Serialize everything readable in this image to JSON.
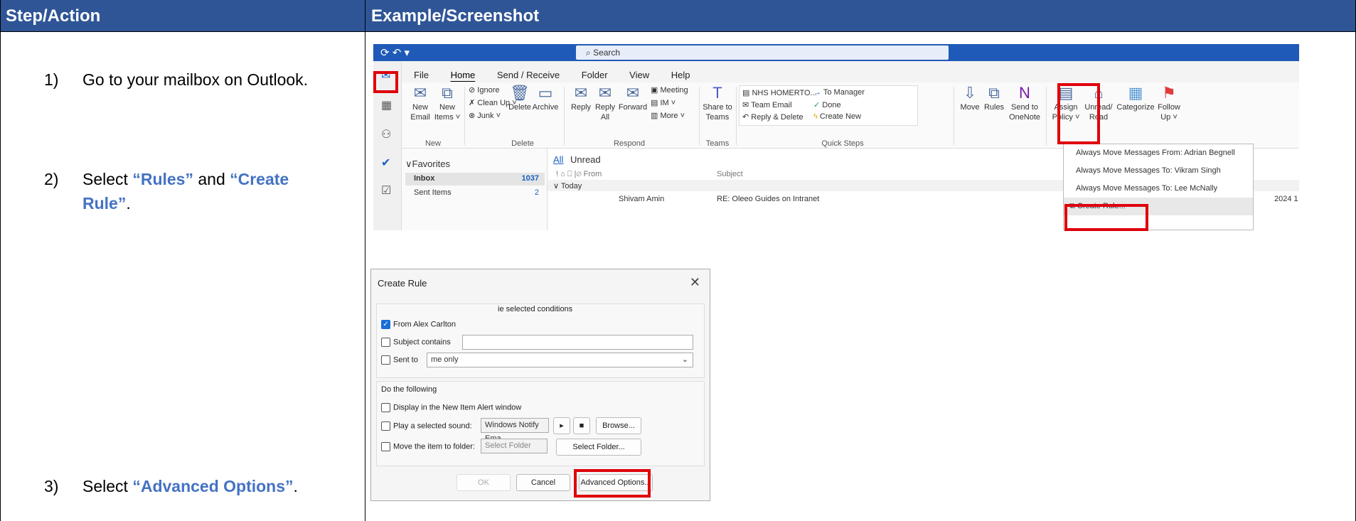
{
  "header": {
    "left": "Step/Action",
    "right": "Example/Screenshot"
  },
  "steps": [
    {
      "num": "1)",
      "text": "Go to your mailbox on Outlook."
    },
    {
      "num": "2)",
      "pre": "Select ",
      "hl1": "“Rules”",
      "mid": " and ",
      "hl2a": "“Create",
      "hl2b": "Rule”",
      "post": "."
    },
    {
      "num": "3)",
      "pre": "Select ",
      "hl": "“Advanced Options”",
      "post": "."
    }
  ],
  "outlook": {
    "search": "Search",
    "menu": [
      "File",
      "Home",
      "Send / Receive",
      "Folder",
      "View",
      "Help"
    ],
    "ribbon": {
      "new_email": "New\nEmail",
      "new_items": "New\nItems ˅",
      "ignore": "Ignore",
      "clean_up": "Clean Up ˅",
      "junk": "Junk ˅",
      "delete": "Delete",
      "archive": "Archive",
      "reply": "Reply",
      "reply_all": "Reply\nAll",
      "forward": "Forward",
      "meeting": "Meeting",
      "im": "IM ˅",
      "more": "More ˅",
      "share_teams": "Share to\nTeams",
      "qs1": "NHS HOMERTO...",
      "qs2": "Team Email",
      "qs3": "Reply & Delete",
      "qs4": "To Manager",
      "qs5": "Done",
      "qs6": "Create New",
      "move": "Move",
      "rules": "Rules",
      "send_onenote": "Send to\nOneNote",
      "assign_policy": "Assign\nPolicy ˅",
      "unread_read": "Unread/\nRead",
      "categorize": "Categorize",
      "follow_up": "Follow\nUp ˅",
      "groups": [
        "New",
        "Delete",
        "Respond",
        "Teams",
        "Quick Steps"
      ]
    },
    "folders": {
      "favorites": "Favorites",
      "inbox": "Inbox",
      "inbox_count": "1037",
      "sent": "Sent Items",
      "sent_count": "2"
    },
    "mail": {
      "tab_all": "All",
      "tab_unread": "Unread",
      "col_from": "From",
      "col_subject": "Subject",
      "group_today": "Today",
      "row_from": "Shivam Amin",
      "row_subject": "RE: Oleeo Guides on Intranet",
      "row_date": "2024 1"
    },
    "rules_menu": [
      "Always Move Messages From: Adrian Begnell",
      "Always Move Messages To: Vikram Singh",
      "Always Move Messages To: Lee McNally",
      "Create Rule..."
    ]
  },
  "dialog": {
    "title": "Create Rule",
    "conditions_header": "ie selected conditions",
    "from": "From Alex Carlton",
    "subject_contains": "Subject contains",
    "sent_to": "Sent to",
    "sent_to_value": "me only",
    "do_following": "Do the following",
    "display_alert": "Display in the New Item Alert window",
    "play_sound": "Play a selected sound:",
    "sound_value": "Windows Notify Ema",
    "browse": "Browse...",
    "move_folder": "Move the item to folder:",
    "folder_placeholder": "Select Folder",
    "select_folder": "Select Folder...",
    "ok": "OK",
    "cancel": "Cancel",
    "advanced": "Advanced Options..."
  }
}
